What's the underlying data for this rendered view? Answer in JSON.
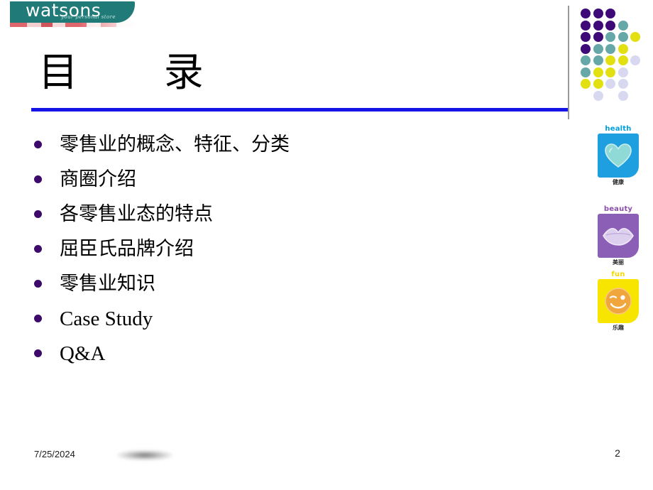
{
  "slide": {
    "title": "目      录",
    "page_number": "2",
    "date": "7/25/2024",
    "accent_rule_color": "#1414e6",
    "bullet_color": "#3d0a6b",
    "background": "#ffffff"
  },
  "logo": {
    "wordmark": "watsons",
    "tagline": "your personal store",
    "bar_color": "#1f7a78",
    "text_color": "#ffffff",
    "stripe_color": "#d94a52"
  },
  "contents": {
    "items": [
      {
        "label": "零售业的概念、特征、分类",
        "script": "cjk"
      },
      {
        "label": "商圈介绍",
        "script": "cjk"
      },
      {
        "label": "各零售业态的特点",
        "script": "cjk"
      },
      {
        "label": "屈臣氏品牌介绍",
        "script": "cjk"
      },
      {
        "label": "零售业知识",
        "script": "cjk"
      },
      {
        "label": "Case Study",
        "script": "latin"
      },
      {
        "label": "Q&A",
        "script": "latin"
      }
    ]
  },
  "dot_matrix": {
    "colors": {
      "purple": "#3d0a78",
      "teal": "#66a8a8",
      "yellow": "#e3e011",
      "lavender": "#d8d8f0"
    },
    "rows": [
      [
        "purple",
        "purple",
        "purple",
        "",
        "",
        ""
      ],
      [
        "purple",
        "purple",
        "purple",
        "teal",
        "",
        ""
      ],
      [
        "purple",
        "purple",
        "teal",
        "teal",
        "yellow",
        ""
      ],
      [
        "purple",
        "teal",
        "teal",
        "yellow",
        "",
        ""
      ],
      [
        "teal",
        "teal",
        "yellow",
        "yellow",
        "lavender",
        ""
      ],
      [
        "teal",
        "yellow",
        "yellow",
        "lavender",
        "",
        ""
      ],
      [
        "yellow",
        "yellow",
        "lavender",
        "lavender",
        "",
        ""
      ],
      [
        "",
        "lavender",
        "",
        "lavender",
        "",
        ""
      ]
    ]
  },
  "categories": [
    {
      "name": "health",
      "name_color": "#00a0e0",
      "box_color": "#1e9fe0",
      "glyph": "heart-icon",
      "glyph_color": "#8fd9d6",
      "chinese": "健康"
    },
    {
      "name": "beauty",
      "name_color": "#8b4fa8",
      "box_color": "#8b5fb5",
      "glyph": "lips-icon",
      "glyph_color": "#ddd0ee",
      "chinese": "美丽"
    },
    {
      "name": "fun",
      "name_color": "#f5d800",
      "box_color": "#f7e500",
      "glyph": "smiley-wink-icon",
      "glyph_color": "#f0a63c",
      "chinese": "乐趣"
    }
  ]
}
